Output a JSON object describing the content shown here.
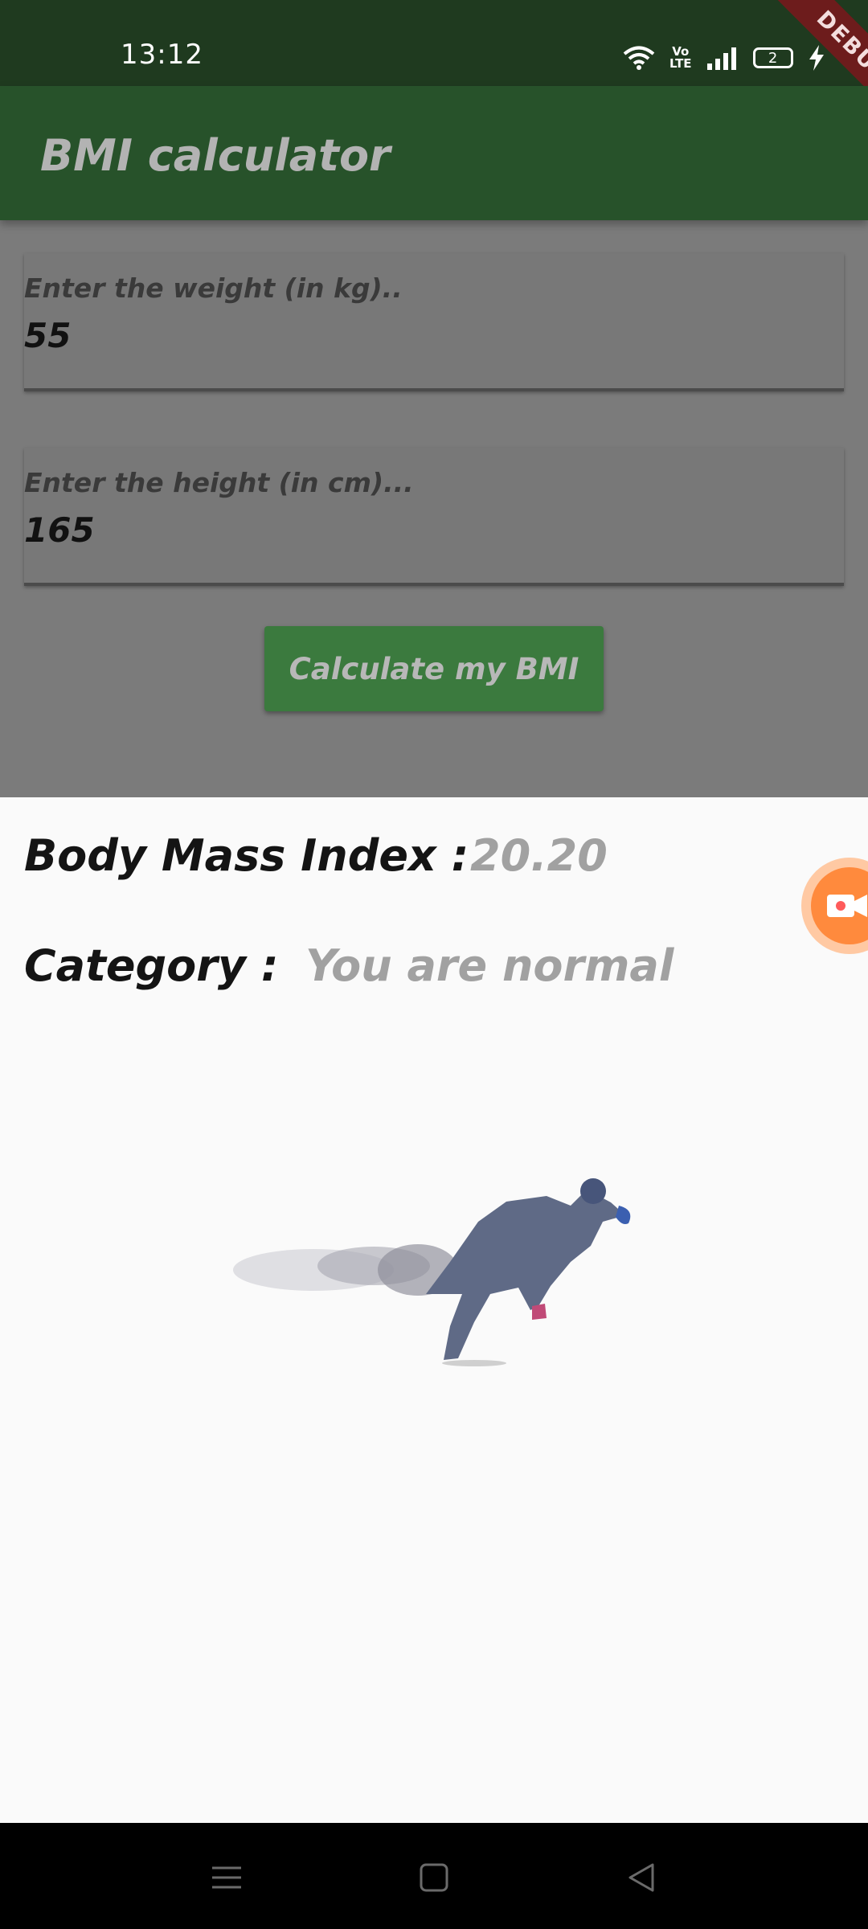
{
  "status_bar": {
    "time": "13:12",
    "lte_top": "Vo",
    "lte_bottom": "LTE",
    "battery_level": "2",
    "icons": [
      "wifi-icon",
      "volte-icon",
      "signal-icon",
      "battery-icon",
      "charging-icon"
    ]
  },
  "debug_banner": "DEBUG",
  "app_bar": {
    "title": "BMI calculator",
    "color": "#27522a"
  },
  "form": {
    "weight": {
      "label": "Enter the weight (in kg)..",
      "value": "55"
    },
    "height": {
      "label": "Enter the height (in cm)...",
      "value": "165"
    },
    "calculate_label": "Calculate my BMI"
  },
  "result": {
    "bmi_label": "Body Mass Index :",
    "bmi_value": "20.20",
    "category_label": "Category :",
    "category_value": "You are normal"
  },
  "image": {
    "icon": "running-man-particles-illustration"
  },
  "nav_bar": {
    "icons": [
      "menu-icon",
      "home-icon",
      "back-icon"
    ]
  }
}
